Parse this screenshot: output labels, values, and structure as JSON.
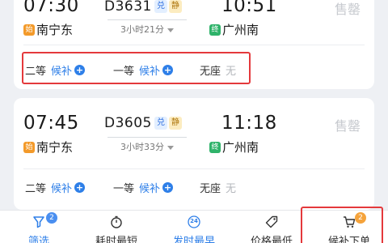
{
  "trains": [
    {
      "dep_time": "07:30",
      "train_no": "D3631",
      "tag_dui": "兑",
      "tag_jing": "静",
      "arr_time": "10:51",
      "dep_badge": "始",
      "dep_station": "南宁东",
      "duration": "3小时21分",
      "arr_badge": "终",
      "arr_station": "广州南",
      "status": "售罄",
      "seats": [
        {
          "class": "二等",
          "state": "候补"
        },
        {
          "class": "一等",
          "state": "候补"
        },
        {
          "class": "无座",
          "state": "无"
        }
      ]
    },
    {
      "dep_time": "07:45",
      "train_no": "D3605",
      "tag_dui": "兑",
      "tag_jing": "静",
      "arr_time": "11:18",
      "dep_badge": "始",
      "dep_station": "南宁东",
      "duration": "3小时33分",
      "arr_badge": "终",
      "arr_station": "广州南",
      "status": "售罄",
      "seats": [
        {
          "class": "二等",
          "state": "候补"
        },
        {
          "class": "一等",
          "state": "候补"
        },
        {
          "class": "无座",
          "state": "无"
        }
      ]
    }
  ],
  "bottom_tabs": [
    {
      "label": "筛选",
      "icon": "filter-icon",
      "badge": "2"
    },
    {
      "label": "耗时最短",
      "icon": "stopwatch-icon"
    },
    {
      "label": "发时最早",
      "icon": "clock-24-icon",
      "icon_text": "24"
    },
    {
      "label": "价格最低",
      "icon": "price-tag-icon"
    },
    {
      "label": "候补下单",
      "icon": "cart-icon",
      "badge": "2"
    }
  ],
  "colors": {
    "accent": "#2e7fe8",
    "highlight": "#e4393c",
    "badge_orange": "#f5a33b"
  }
}
